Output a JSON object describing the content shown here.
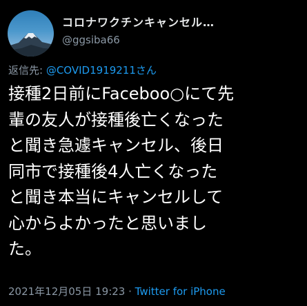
{
  "author": {
    "display_name": "コロナワクチンキャンセル…",
    "handle": "@ggsiba66",
    "avatar_icon": "mount-fuji-avatar-icon"
  },
  "reply": {
    "prefix": "返信先: ",
    "mention": "@COVID1919211さん"
  },
  "tweet": {
    "lines": [
      "接種2日前にFaceboo○にて先",
      "輩の友人が接種後亡くなった",
      "と聞き急遽キャンセル、後日",
      "同市で接種後4人亡くなった",
      "と聞き本当にキャンセルして",
      "心からよかったと思いまし",
      "た。"
    ]
  },
  "meta": {
    "timestamp": "2021年12月05日 19:23",
    "separator": " · ",
    "client": "Twitter for iPhone"
  },
  "colors": {
    "background": "#000000",
    "text": "#ffffff",
    "secondary": "#8b98a5",
    "link": "#1d9bf0"
  }
}
